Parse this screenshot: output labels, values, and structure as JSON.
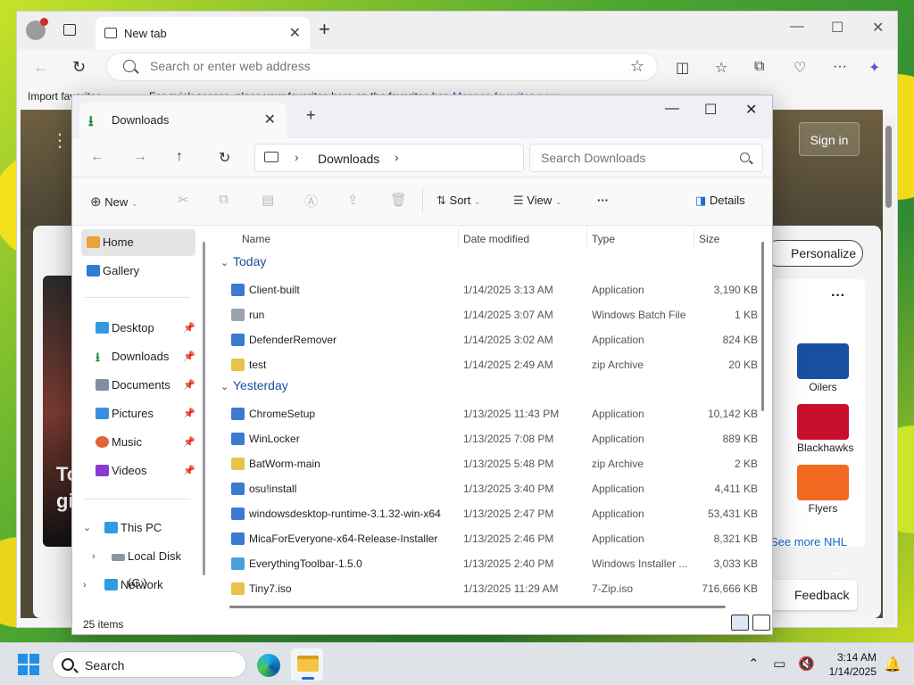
{
  "browser": {
    "tab_title": "New tab",
    "address_placeholder": "Search or enter web address",
    "fav_import": "Import favorites",
    "fav_message": "For quick access, place your favorites here on the favorites bar.",
    "fav_link": "Manage favorites now",
    "sign_in": "Sign in",
    "personalize": "Personalize",
    "see_more": "See more NHL",
    "feedback": "Feedback",
    "hero_text_1": "To",
    "hero_text_2": "gi",
    "teams": [
      {
        "name": "Oilers",
        "color": "#1a4fa0"
      },
      {
        "name": "Blackhawks",
        "color": "#c8102e"
      },
      {
        "name": "Flyers",
        "color": "#f26a21"
      }
    ]
  },
  "explorer": {
    "tab_title": "Downloads",
    "breadcrumb": "Downloads",
    "search_placeholder": "Search Downloads",
    "commands": {
      "new": "New",
      "sort": "Sort",
      "view": "View",
      "more": "···",
      "details": "Details"
    },
    "sidebar": {
      "home": "Home",
      "gallery": "Gallery",
      "desktop": "Desktop",
      "downloads": "Downloads",
      "documents": "Documents",
      "pictures": "Pictures",
      "music": "Music",
      "videos": "Videos",
      "this_pc": "This PC",
      "local_disk": "Local Disk (C:)",
      "network": "Network"
    },
    "columns": {
      "name": "Name",
      "date": "Date modified",
      "type": "Type",
      "size": "Size"
    },
    "groups": {
      "today": "Today",
      "yesterday": "Yesterday"
    },
    "files_today": [
      {
        "name": "Client-built",
        "date": "1/14/2025 3:13 AM",
        "type": "Application",
        "size": "3,190 KB"
      },
      {
        "name": "run",
        "date": "1/14/2025 3:07 AM",
        "type": "Windows Batch File",
        "size": "1 KB"
      },
      {
        "name": "DefenderRemover",
        "date": "1/14/2025 3:02 AM",
        "type": "Application",
        "size": "824 KB"
      },
      {
        "name": "test",
        "date": "1/14/2025 2:49 AM",
        "type": "zip Archive",
        "size": "20 KB"
      }
    ],
    "files_yesterday": [
      {
        "name": "ChromeSetup",
        "date": "1/13/2025 11:43 PM",
        "type": "Application",
        "size": "10,142 KB"
      },
      {
        "name": "WinLocker",
        "date": "1/13/2025 7:08 PM",
        "type": "Application",
        "size": "889 KB"
      },
      {
        "name": "BatWorm-main",
        "date": "1/13/2025 5:48 PM",
        "type": "zip Archive",
        "size": "2 KB"
      },
      {
        "name": "osu!install",
        "date": "1/13/2025 3:40 PM",
        "type": "Application",
        "size": "4,411 KB"
      },
      {
        "name": "windowsdesktop-runtime-3.1.32-win-x64",
        "date": "1/13/2025 2:47 PM",
        "type": "Application",
        "size": "53,431 KB"
      },
      {
        "name": "MicaForEveryone-x64-Release-Installer",
        "date": "1/13/2025 2:46 PM",
        "type": "Application",
        "size": "8,321 KB"
      },
      {
        "name": "EverythingToolbar-1.5.0",
        "date": "1/13/2025 2:40 PM",
        "type": "Windows Installer ...",
        "size": "3,033 KB"
      },
      {
        "name": "Tiny7.iso",
        "date": "1/13/2025 11:29 AM",
        "type": "7-Zip.iso",
        "size": "716,666 KB"
      }
    ],
    "status": "25 items"
  },
  "taskbar": {
    "search": "Search",
    "time": "3:14 AM",
    "date": "1/14/2025"
  },
  "colors": {
    "accent": "#1a6fd4",
    "group_header": "#1a4f9c"
  }
}
